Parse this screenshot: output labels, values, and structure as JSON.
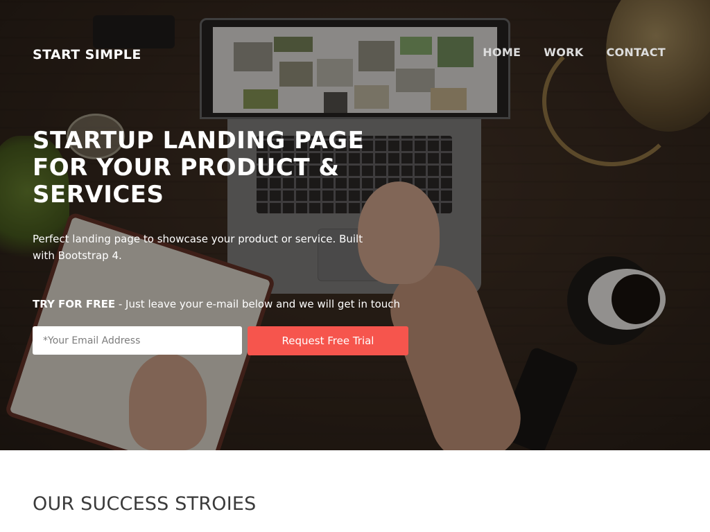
{
  "brand": {
    "name": "START SIMPLE"
  },
  "nav": {
    "items": [
      "HOME",
      "WORK",
      "CONTACT"
    ]
  },
  "hero": {
    "headline": "STARTUP LANDING PAGE FOR YOUR PRODUCT & SERVICES",
    "subhead": "Perfect landing page to showcase your product or service. Built with Bootstrap 4.",
    "cta_strong": "TRY FOR FREE",
    "cta_rest": " - Just leave your e-mail below and we will get in touch",
    "email_placeholder": "*Your Email Address",
    "button_label": "Request Free Trial"
  },
  "section": {
    "title": "OUR SUCCESS STROIES"
  },
  "colors": {
    "accent": "#f6554d",
    "hero_overlay": "#140e0a",
    "text_dark": "#3a3a3a"
  }
}
